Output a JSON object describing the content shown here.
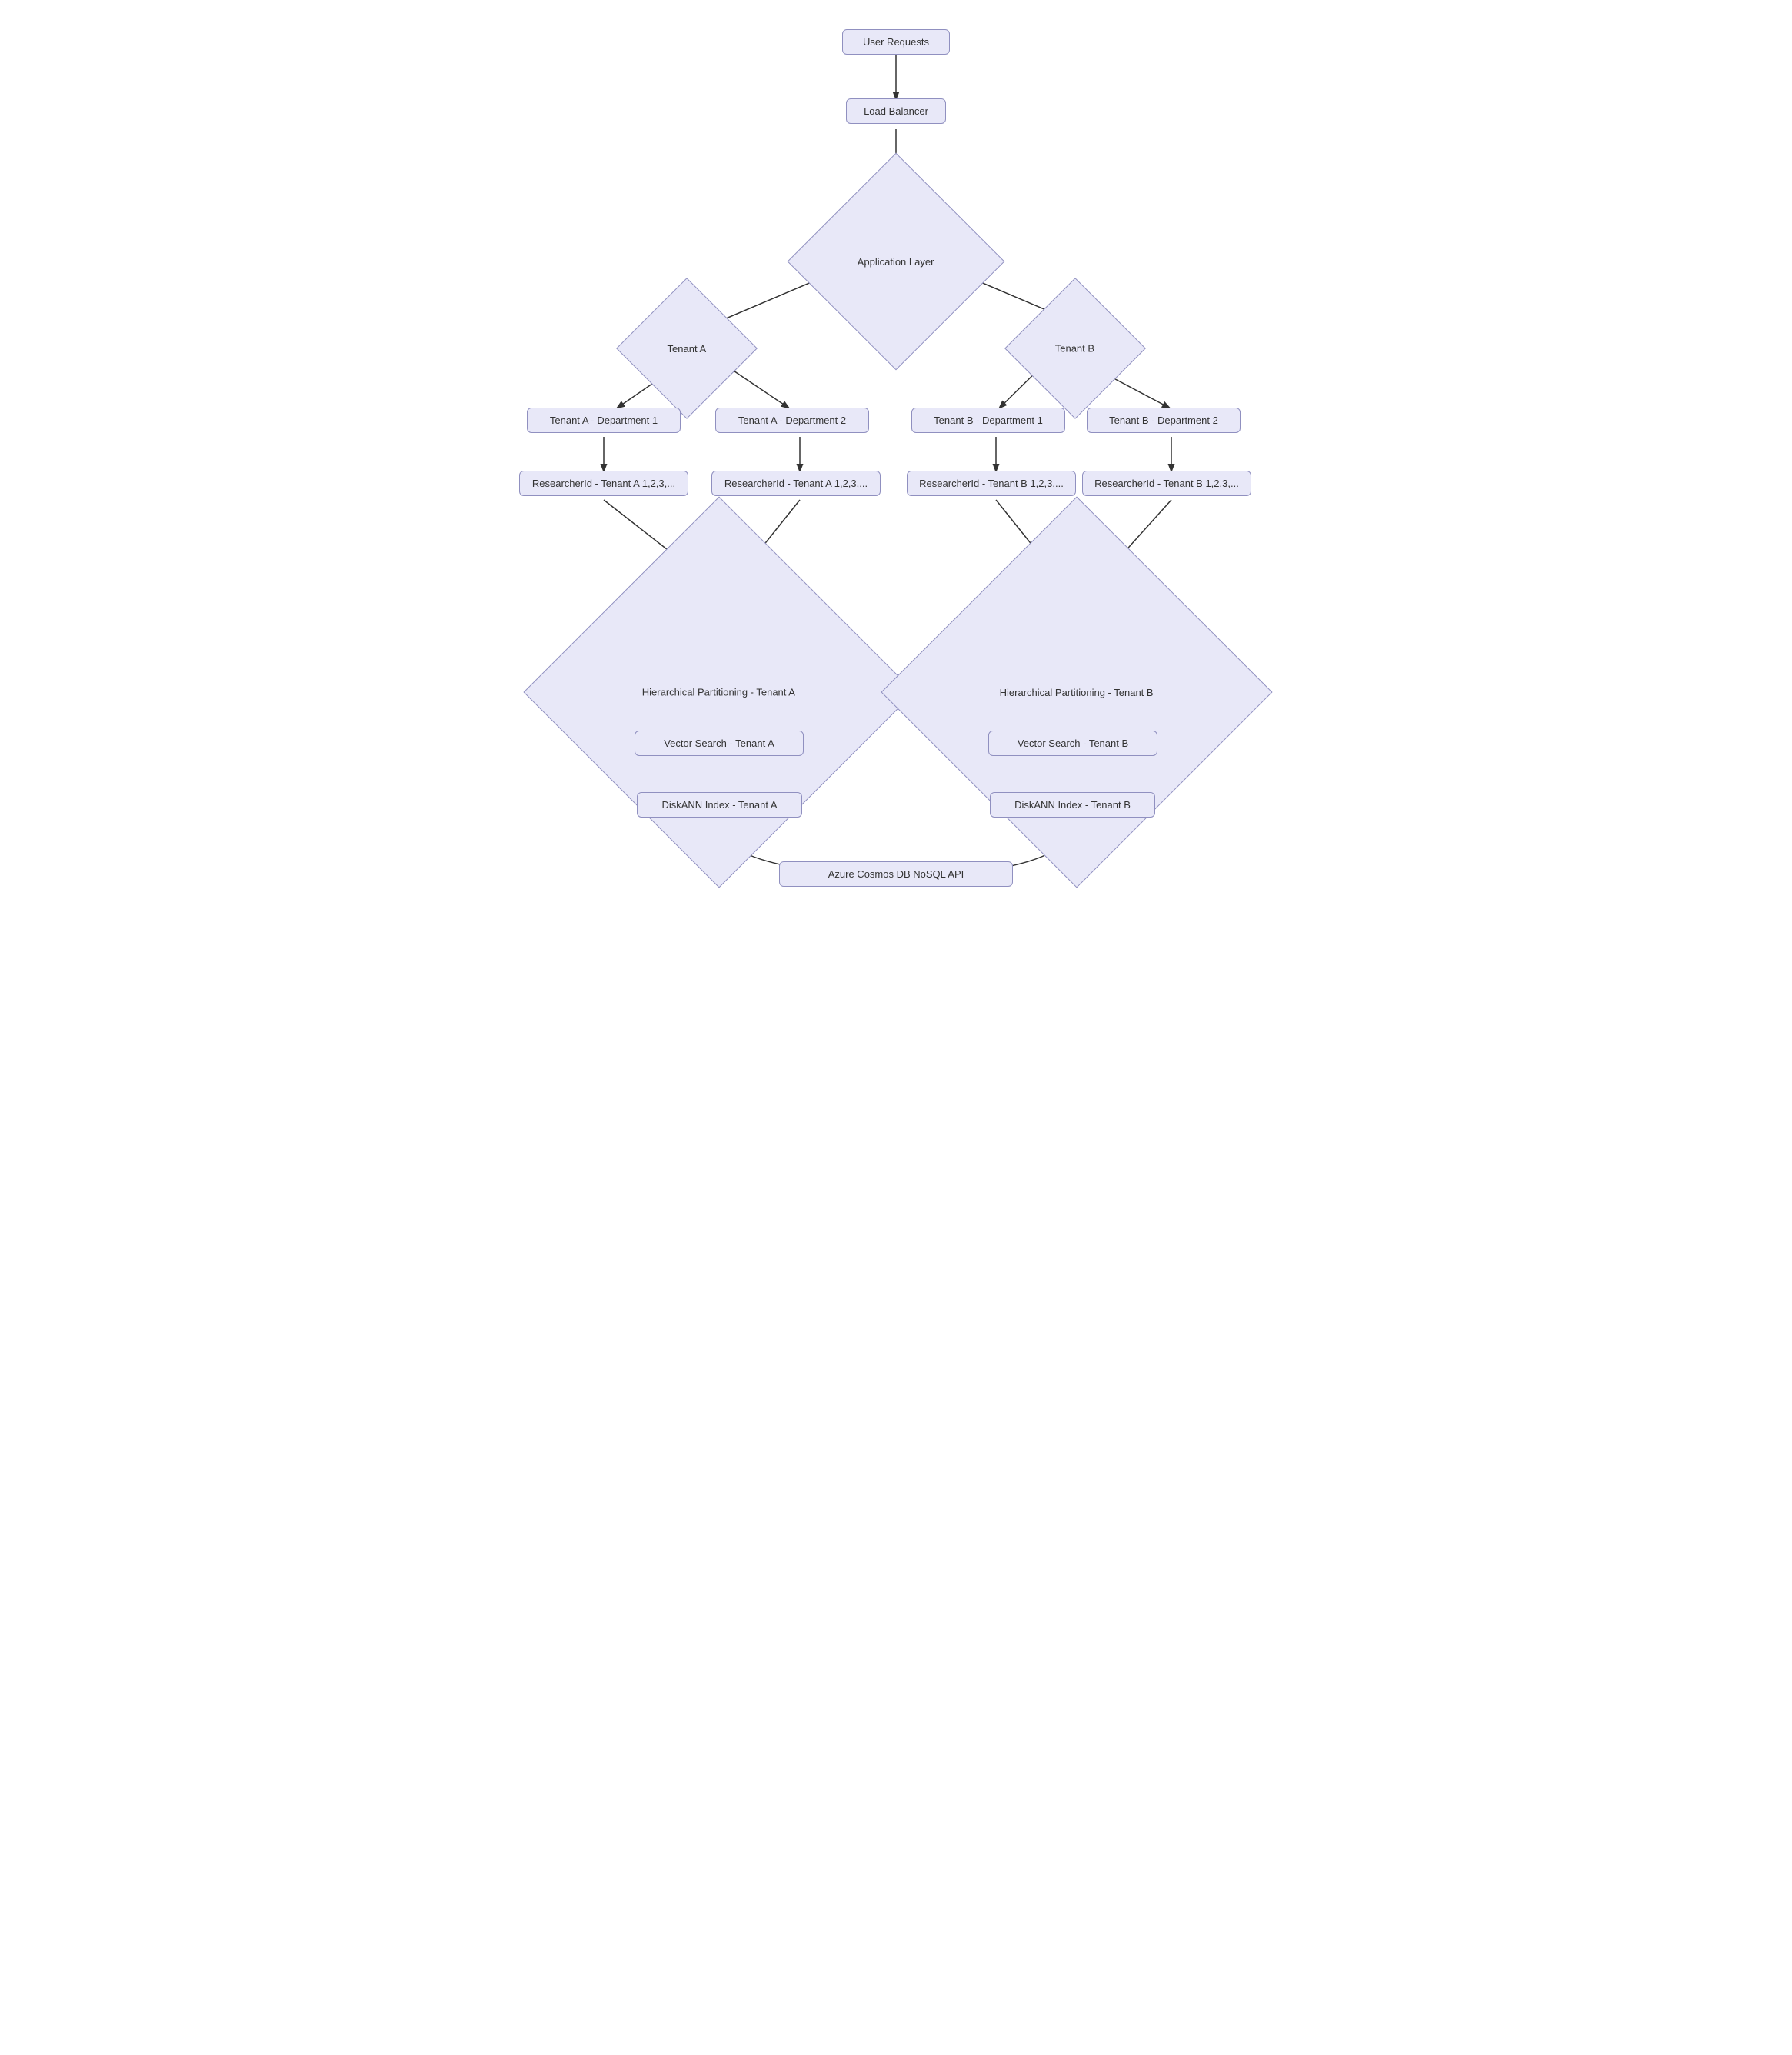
{
  "nodes": {
    "user_requests": {
      "label": "User Requests"
    },
    "load_balancer": {
      "label": "Load Balancer"
    },
    "application_layer": {
      "label": "Application Layer"
    },
    "tenant_a": {
      "label": "Tenant A"
    },
    "tenant_b": {
      "label": "Tenant B"
    },
    "tenant_a_dept1": {
      "label": "Tenant A - Department 1"
    },
    "tenant_a_dept2": {
      "label": "Tenant A - Department 2"
    },
    "tenant_b_dept1": {
      "label": "Tenant B - Department 1"
    },
    "tenant_b_dept2": {
      "label": "Tenant B - Department 2"
    },
    "researcher_a1": {
      "label": "ResearcherId - Tenant A 1,2,3,..."
    },
    "researcher_a2": {
      "label": "ResearcherId - Tenant A 1,2,3,..."
    },
    "researcher_b1": {
      "label": "ResearcherId - Tenant B 1,2,3,..."
    },
    "researcher_b2": {
      "label": "ResearcherId - Tenant B 1,2,3,..."
    },
    "hier_part_a": {
      "label": "Hierarchical Partitioning - Tenant A"
    },
    "hier_part_b": {
      "label": "Hierarchical Partitioning - Tenant B"
    },
    "vector_search_a": {
      "label": "Vector Search - Tenant A"
    },
    "vector_search_b": {
      "label": "Vector Search - Tenant B"
    },
    "diskann_a": {
      "label": "DiskANN Index - Tenant A"
    },
    "diskann_b": {
      "label": "DiskANN Index - Tenant B"
    },
    "cosmos_db": {
      "label": "Azure Cosmos DB NoSQL API"
    }
  }
}
